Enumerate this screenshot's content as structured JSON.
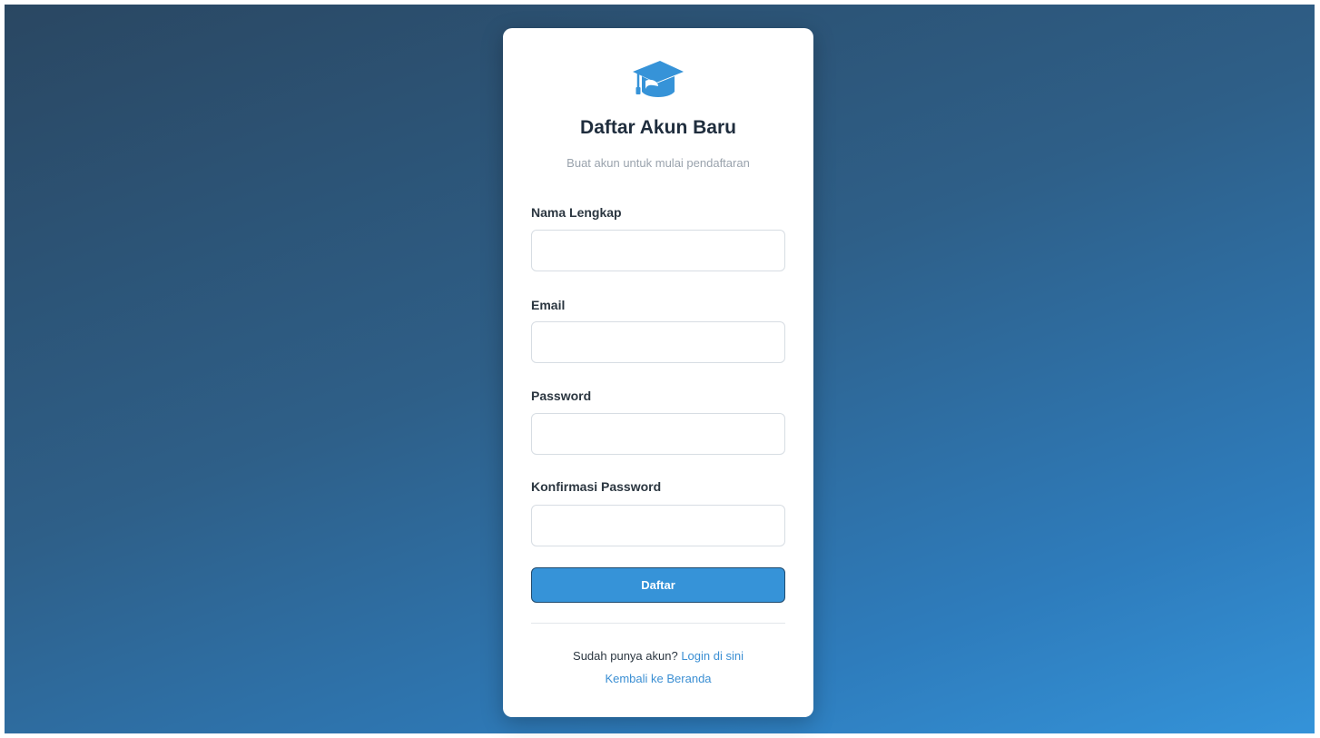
{
  "form": {
    "title": "Daftar Akun Baru",
    "subtitle": "Buat akun untuk mulai pendaftaran",
    "logo_icon": "graduation-cap-icon",
    "fields": [
      {
        "label": "Nama Lengkap",
        "value": "",
        "placeholder": ""
      },
      {
        "label": "Email",
        "value": "",
        "placeholder": ""
      },
      {
        "label": "Password",
        "value": "",
        "placeholder": ""
      },
      {
        "label": "Konfirmasi Password",
        "value": "",
        "placeholder": ""
      }
    ],
    "submit_label": "Daftar"
  },
  "footer": {
    "have_account_text": "Sudah punya akun?",
    "login_link": "Login di sini",
    "home_link": "Kembali ke Beranda"
  },
  "colors": {
    "accent": "#3693d8",
    "link": "#3b8fd3",
    "title": "#1f2d3d"
  }
}
